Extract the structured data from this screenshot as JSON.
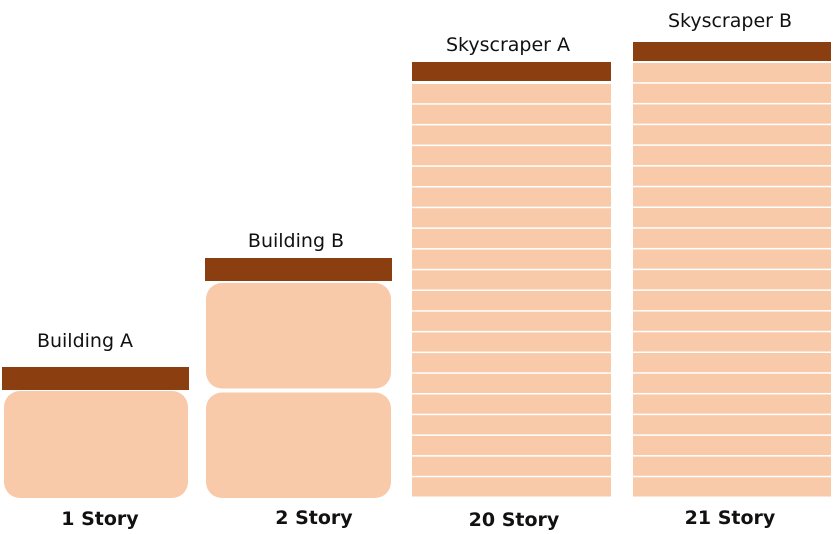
{
  "colors": {
    "roof": "#8B3E0F",
    "floor": "#F8CAA9",
    "floor_line": "#FFFFFF",
    "text": "#111111"
  },
  "buildings": [
    {
      "name": "Building A",
      "stories": 1,
      "story_label": "1 Story",
      "style": "rounded"
    },
    {
      "name": "Building B",
      "stories": 2,
      "story_label": "2 Story",
      "style": "rounded"
    },
    {
      "name": "Skyscraper A",
      "stories": 20,
      "story_label": "20 Story",
      "style": "stripes"
    },
    {
      "name": "Skyscraper B",
      "stories": 21,
      "story_label": "21 Story",
      "style": "stripes"
    }
  ]
}
